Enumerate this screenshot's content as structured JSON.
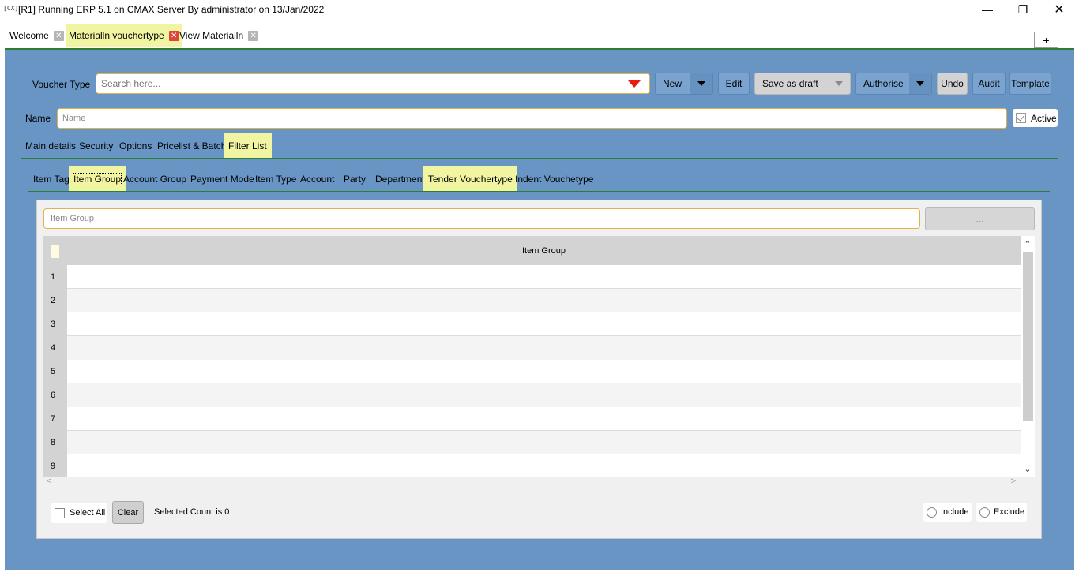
{
  "window": {
    "app_icon": "[CX]",
    "title": "[R1] Running ERP 5.1 on CMAX Server By administrator on 13/Jan/2022",
    "minimize": "—",
    "maximize": "❐",
    "close": "✕"
  },
  "tabs": [
    {
      "label": "Welcome",
      "active": false
    },
    {
      "label": "Materialln vouchertype",
      "active": true
    },
    {
      "label": "View Materialln",
      "active": false
    }
  ],
  "tab_close_glyph": "✕",
  "add_tab_label": "+",
  "voucher": {
    "label": "Voucher Type",
    "search_placeholder": "Search here..."
  },
  "toolbar": {
    "new": "New",
    "edit": "Edit",
    "save_as_draft": "Save as draft",
    "authorise": "Authorise",
    "undo": "Undo",
    "audit": "Audit",
    "template": "Template"
  },
  "name_field": {
    "label": "Name",
    "placeholder": "Name"
  },
  "active_checkbox": {
    "label": "Active",
    "checked": true
  },
  "section_tabs": [
    {
      "label": "Main details",
      "active": false
    },
    {
      "label": "Security",
      "active": false
    },
    {
      "label": "Options",
      "active": false
    },
    {
      "label": "Pricelist & Batch",
      "active": false
    },
    {
      "label": "Filter List",
      "active": true
    }
  ],
  "filter_tabs": [
    {
      "label": "Item Tag",
      "active": false
    },
    {
      "label": "Item Group",
      "active": true
    },
    {
      "label": "Account Group",
      "active": false
    },
    {
      "label": "Payment Mode",
      "active": false
    },
    {
      "label": "Item Type",
      "active": false
    },
    {
      "label": "Account",
      "active": false
    },
    {
      "label": "Party",
      "active": false
    },
    {
      "label": "Department",
      "active": false
    },
    {
      "label": "Tender Vouchertype",
      "active": true
    },
    {
      "label": "Indent Vouchetype",
      "active": false
    }
  ],
  "filter_panel": {
    "input_placeholder": "Item Group",
    "browse_label": "...",
    "column_header": "Item Group",
    "row_numbers": [
      "1",
      "2",
      "3",
      "4",
      "5",
      "6",
      "7",
      "8",
      "9"
    ],
    "select_all": "Select All",
    "clear": "Clear",
    "selected_count": "Selected Count is 0",
    "include": "Include",
    "exclude": "Exclude"
  },
  "scroll": {
    "up": "⌃",
    "down": "⌄",
    "left": "<",
    "right": ">"
  },
  "colors": {
    "panel_bg": "#6895c4",
    "highlight": "#f1f4a0",
    "accent_line": "#2e7d32",
    "input_border": "#e0b24a",
    "tab_close_active": "#e0443a"
  }
}
